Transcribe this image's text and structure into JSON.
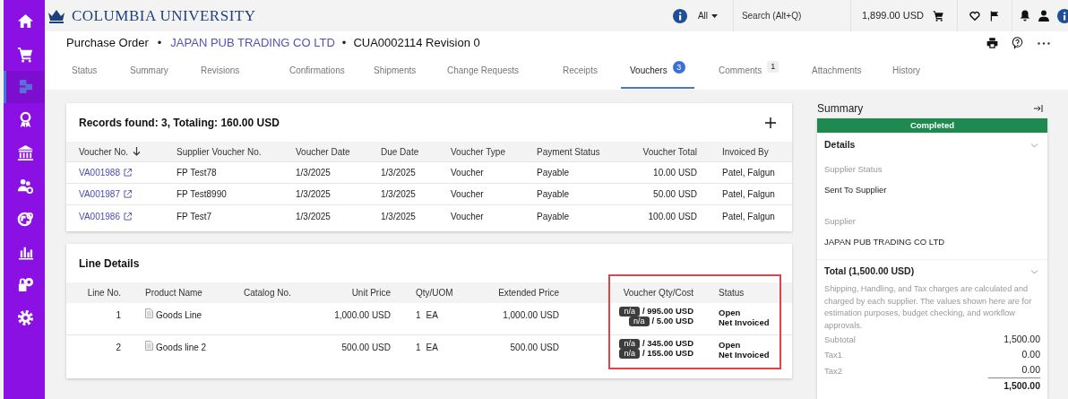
{
  "sidebar": {
    "items": [
      {
        "kind": "home",
        "selected": false
      },
      {
        "kind": "cart",
        "selected": false
      },
      {
        "kind": "boxes",
        "selected": true
      },
      {
        "kind": "award",
        "selected": false
      },
      {
        "kind": "bank",
        "selected": false
      },
      {
        "kind": "people",
        "selected": false
      },
      {
        "kind": "globe",
        "selected": false
      },
      {
        "kind": "chart",
        "selected": false
      },
      {
        "kind": "lockgear",
        "selected": false
      },
      {
        "kind": "gear",
        "selected": false
      }
    ]
  },
  "top_bar": {
    "logo": "COLUMBIA UNIVERSITY",
    "scope": "All",
    "search": {
      "placeholder": "Search (Alt+Q)"
    },
    "cart_total": "1,899.00 USD"
  },
  "page_header": {
    "title": "Purchase Order",
    "separator": "•",
    "supplier": "JAPAN PUB TRADING CO LTD",
    "document": "CUA0002114 Revision 0"
  },
  "tabs": [
    {
      "label": "Status",
      "selected": false
    },
    {
      "label": "Summary",
      "selected": false
    },
    {
      "label": "Revisions",
      "selected": false
    },
    {
      "label": "Confirmations",
      "selected": false
    },
    {
      "label": "Shipments",
      "selected": false
    },
    {
      "label": "Change Requests",
      "selected": false
    },
    {
      "label": "Receipts",
      "selected": false
    },
    {
      "label": "Vouchers",
      "selected": true,
      "badge": "3"
    },
    {
      "label": "Comments",
      "selected": false,
      "badge": "1"
    },
    {
      "label": "Attachments",
      "selected": false
    },
    {
      "label": "History",
      "selected": false
    }
  ],
  "vouchers": {
    "title": "Records found: 3, Totaling: 160.00 USD",
    "columns": [
      {
        "label": "Voucher No.",
        "sorted_descending": true
      },
      {
        "label": "Supplier Voucher No."
      },
      {
        "label": "Voucher Date"
      },
      {
        "label": "Due Date"
      },
      {
        "label": "Voucher Type"
      },
      {
        "label": "Payment Status"
      },
      {
        "label": "Voucher Total"
      },
      {
        "label": "Invoiced By"
      }
    ],
    "rows": [
      {
        "voucher_no": "VA001988",
        "supplier_voucher_no": "FP Test78",
        "voucher_date": "1/3/2025",
        "due_date": "1/3/2025",
        "voucher_type": "Voucher",
        "payment_status": "Payable",
        "voucher_total": "10.00 USD",
        "invoiced_by": "Patel, Falgun"
      },
      {
        "voucher_no": "VA001987",
        "supplier_voucher_no": "FP Test8990",
        "voucher_date": "1/3/2025",
        "due_date": "1/3/2025",
        "voucher_type": "Voucher",
        "payment_status": "Payable",
        "voucher_total": "50.00 USD",
        "invoiced_by": "Patel, Falgun"
      },
      {
        "voucher_no": "VA001986",
        "supplier_voucher_no": "FP Test7",
        "voucher_date": "1/3/2025",
        "due_date": "1/3/2025",
        "voucher_type": "Voucher",
        "payment_status": "Payable",
        "voucher_total": "100.00 USD",
        "invoiced_by": "Patel, Falgun"
      }
    ]
  },
  "line_details": {
    "title": "Line Details",
    "highlighted": true,
    "columns": [
      "Line No.",
      "Product Name",
      "Catalog No.",
      "Unit Price",
      "Qty/UOM",
      "Extended Price",
      "Voucher Qty/Cost",
      "Status"
    ],
    "rows": [
      {
        "line_no": "1",
        "product_name": "Goods Line",
        "unit_price": "1,000.00 USD",
        "qty": "1",
        "uom": "EA",
        "extended_price": "1,000.00 USD",
        "voucher_costs": [
          {
            "qty": "n/a",
            "cost": "/ 995.00 USD"
          },
          {
            "qty": "n/a",
            "cost": "/ 5.00 USD"
          }
        ],
        "statuses": [
          "Open",
          "Net Invoiced"
        ]
      },
      {
        "line_no": "2",
        "product_name": "Goods line 2",
        "unit_price": "500.00 USD",
        "qty": "1",
        "uom": "EA",
        "extended_price": "500.00 USD",
        "voucher_costs": [
          {
            "qty": "n/a",
            "cost": "/ 345.00 USD"
          },
          {
            "qty": "n/a",
            "cost": "/ 155.00 USD"
          }
        ],
        "statuses": [
          "Open",
          "Net Invoiced"
        ]
      }
    ]
  },
  "summary": {
    "title": "Summary",
    "status": "Completed",
    "details": {
      "title": "Details",
      "fields": [
        {
          "label": "Supplier Status",
          "value": "Sent To Supplier"
        },
        {
          "label": "Supplier",
          "value": "JAPAN PUB TRADING CO LTD"
        }
      ]
    },
    "total": {
      "title": "Total (1,500.00 USD)",
      "note": "Shipping, Handling, and Tax charges are calculated and charged by each supplier. The values shown here are for estimation purposes, budget checking, and workflow approvals.",
      "lines": [
        {
          "label": "Subtotal",
          "value": "1,500.00"
        },
        {
          "label": "Tax1",
          "value": "0.00"
        },
        {
          "label": "Tax2",
          "value": "0.00"
        }
      ],
      "grand_total": "1,500.00"
    }
  }
}
